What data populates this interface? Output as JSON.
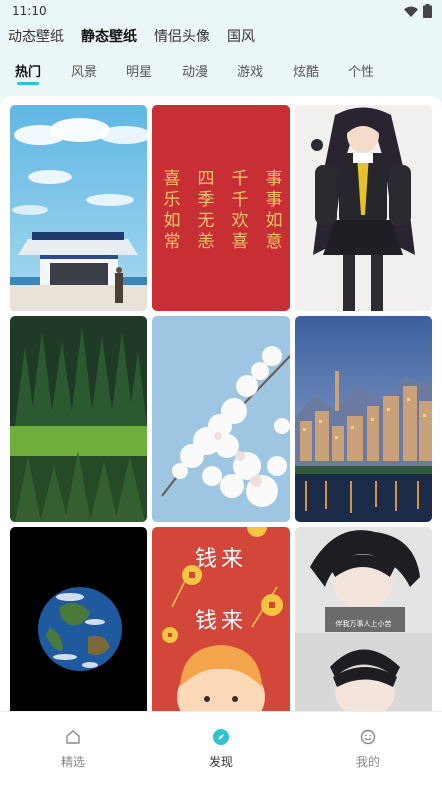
{
  "status_bar": {
    "time": "11:10"
  },
  "category_tabs": [
    {
      "label": "动态壁纸",
      "active": false
    },
    {
      "label": "静态壁纸",
      "active": true
    },
    {
      "label": "情侣头像",
      "active": false
    },
    {
      "label": "国风",
      "active": false
    }
  ],
  "sub_tabs": [
    {
      "label": "热门",
      "active": true
    },
    {
      "label": "风景",
      "active": false
    },
    {
      "label": "明星",
      "active": false
    },
    {
      "label": "动漫",
      "active": false
    },
    {
      "label": "游戏",
      "active": false
    },
    {
      "label": "炫酷",
      "active": false
    },
    {
      "label": "个性",
      "active": false
    }
  ],
  "wallpapers": {
    "red_calligraphy": {
      "columns": [
        "事事如意",
        "千千欢喜",
        "四季无恙",
        "喜乐如常"
      ]
    },
    "money_coming": {
      "line1": "钱来",
      "line2": "钱来"
    },
    "anime_boy": {
      "caption": "伴我万事人上小苦"
    }
  },
  "bottom_nav": [
    {
      "label": "精选",
      "icon": "home-icon",
      "active": false
    },
    {
      "label": "发现",
      "icon": "compass-icon",
      "active": true
    },
    {
      "label": "我的",
      "icon": "smile-icon",
      "active": false
    }
  ],
  "colors": {
    "accent": "#2ec4cf",
    "background": "#eaf6f7"
  }
}
